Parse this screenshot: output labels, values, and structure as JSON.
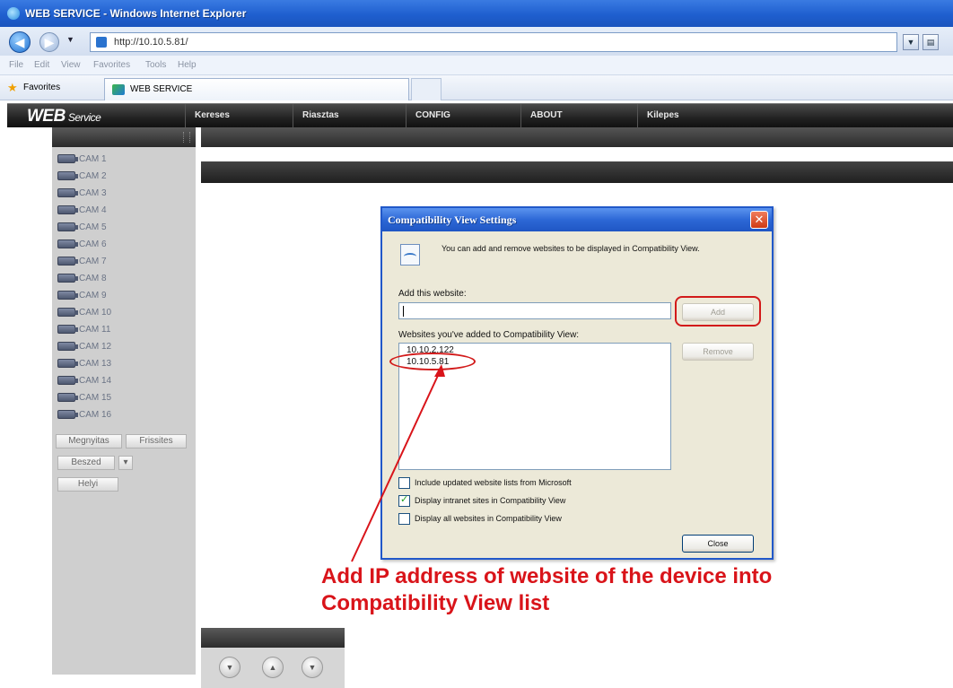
{
  "window": {
    "title": "WEB SERVICE - Windows Internet Explorer"
  },
  "address_bar": {
    "url": "http://10.10.5.81/"
  },
  "menu": [
    "File",
    "Edit",
    "View",
    "Favorites",
    "Tools",
    "Help"
  ],
  "favorites_bar": {
    "favorites_label": "Favorites",
    "tab_title": "WEB SERVICE"
  },
  "app": {
    "logo_main": "WEB",
    "logo_sub": "Service",
    "nav": [
      "Kereses",
      "Riasztas",
      "CONFIG",
      "ABOUT",
      "Kilepes"
    ]
  },
  "sidebar": {
    "cameras": [
      "CAM 1",
      "CAM 2",
      "CAM 3",
      "CAM 4",
      "CAM 5",
      "CAM 6",
      "CAM 7",
      "CAM 8",
      "CAM 9",
      "CAM 10",
      "CAM 11",
      "CAM 12",
      "CAM 13",
      "CAM 14",
      "CAM 15",
      "CAM 16"
    ],
    "open_btn": "Megnyitas",
    "refresh_btn": "Frissites",
    "talk_btn": "Beszed",
    "talk_dropdown": "▾",
    "local_btn": "Helyi"
  },
  "dialog": {
    "title": "Compatibility View Settings",
    "close_glyph": "✕",
    "info": "You can add and remove websites to be displayed in Compatibility View.",
    "add_label": "Add this website:",
    "add_button": "Add",
    "list_label": "Websites you've added to Compatibility View:",
    "websites": [
      "10.10.2.122",
      "10.10.5.81"
    ],
    "remove_button": "Remove",
    "checkboxes": [
      {
        "label": "Include updated website lists from Microsoft",
        "checked": false
      },
      {
        "label": "Display intranet sites in Compatibility View",
        "checked": true
      },
      {
        "label": "Display all websites in Compatibility View",
        "checked": false
      }
    ],
    "close_button": "Close"
  },
  "annotation": {
    "line1": "Add IP address of website of the device into",
    "line2": "Compatibility  View list",
    "color": "#d9141a"
  }
}
